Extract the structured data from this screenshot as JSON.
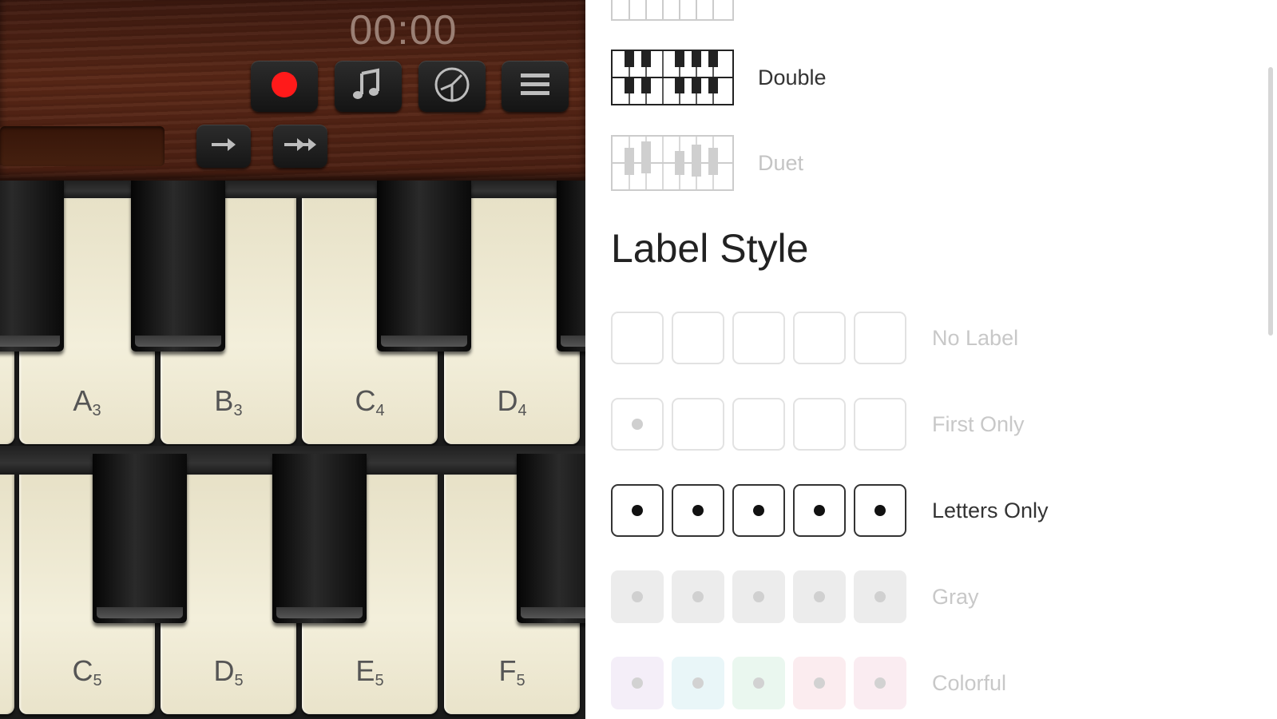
{
  "toolbar": {
    "timer": "00:00",
    "buttons": [
      {
        "name": "record-button",
        "icon": "record-icon"
      },
      {
        "name": "song-button",
        "icon": "music-note-icon"
      },
      {
        "name": "metronome-button",
        "icon": "metronome-icon"
      },
      {
        "name": "menu-button",
        "icon": "hamburger-icon"
      }
    ],
    "nav": [
      {
        "name": "next-button",
        "icon": "arrow-right-icon"
      },
      {
        "name": "fast-forward-button",
        "icon": "double-arrow-right-icon"
      }
    ]
  },
  "keyboard": {
    "upper_keys": [
      {
        "note": "A",
        "octave": "3"
      },
      {
        "note": "B",
        "octave": "3"
      },
      {
        "note": "C",
        "octave": "4"
      },
      {
        "note": "D",
        "octave": "4"
      }
    ],
    "lower_keys": [
      {
        "note": "C",
        "octave": "5"
      },
      {
        "note": "D",
        "octave": "5"
      },
      {
        "note": "E",
        "octave": "5"
      },
      {
        "note": "F",
        "octave": "5"
      }
    ]
  },
  "settings": {
    "layouts": [
      {
        "label": "Double",
        "selected": true
      },
      {
        "label": "Duet",
        "selected": false
      }
    ],
    "label_style_heading": "Label Style",
    "label_styles": [
      {
        "label": "No Label",
        "selected": false
      },
      {
        "label": "First Only",
        "selected": false
      },
      {
        "label": "Letters Only",
        "selected": true
      },
      {
        "label": "Gray",
        "selected": false
      },
      {
        "label": "Colorful",
        "selected": false
      }
    ],
    "colorful_palette": [
      "#f4eef8",
      "#e9f6f8",
      "#eaf7ef",
      "#fbecef",
      "#faecf1"
    ],
    "accent": "#ff1a1a"
  }
}
